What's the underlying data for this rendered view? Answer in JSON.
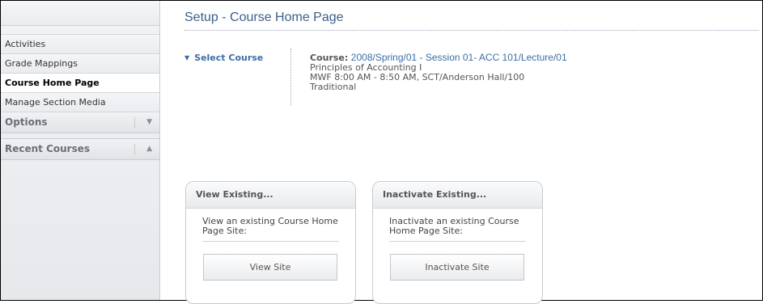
{
  "sidebar": {
    "items": [
      {
        "label": "Activities"
      },
      {
        "label": "Grade Mappings"
      },
      {
        "label": "Course Home Page"
      },
      {
        "label": "Manage Section Media"
      }
    ],
    "options_header": "Options",
    "recent_header": "Recent Courses"
  },
  "page": {
    "title": "Setup - Course Home Page"
  },
  "course": {
    "select_label": "Select Course",
    "label": "Course:",
    "value": "2008/Spring/01 - Session 01- ACC 101/Lecture/01",
    "name": "Principles of Accounting I",
    "schedule": "MWF 8:00 AM - 8:50 AM, SCT/Anderson Hall/100",
    "type": "Traditional"
  },
  "panels": {
    "view": {
      "title": "View Existing...",
      "text": "View an existing Course Home Page Site:",
      "button": "View Site"
    },
    "inactivate": {
      "title": "Inactivate Existing...",
      "text": "Inactivate an existing Course Home Page Site:",
      "button": "Inactivate Site"
    }
  }
}
